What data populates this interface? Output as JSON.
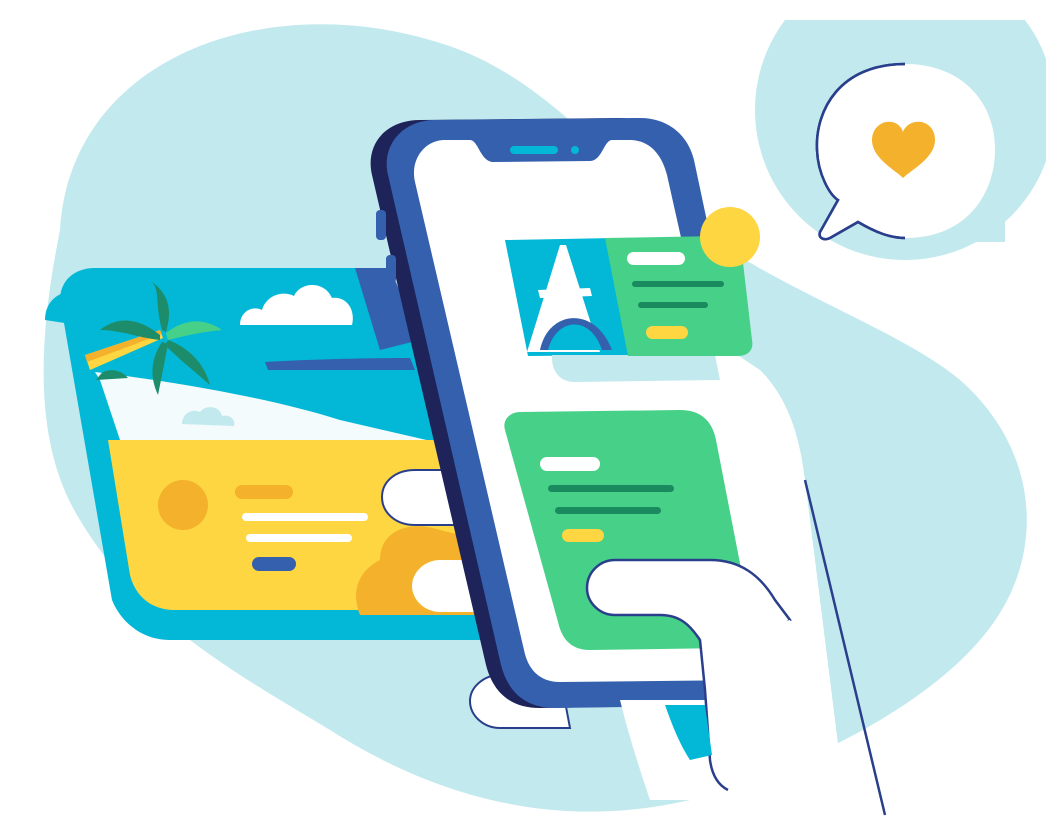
{
  "illustration": {
    "subject": "",
    "colors": {
      "background_blob": "#c2e9ee",
      "phone_body": "#3460ad",
      "phone_shadow": "#1e235a",
      "sky_cyan": "#03b8d6",
      "sand_yellow": "#fed641",
      "orange": "#f4b12b",
      "green": "#47d188",
      "dark_green": "#1a8a5f",
      "palm_green": "#1d8c6a",
      "heart": "#f4b12b",
      "outline": "#2a3f8c",
      "white": "#ffffff"
    },
    "icons": [
      "heart-icon",
      "speech-bubble-icon",
      "eiffel-tower-icon",
      "palm-tree-icon",
      "cloud-icon",
      "sun-icon"
    ]
  }
}
